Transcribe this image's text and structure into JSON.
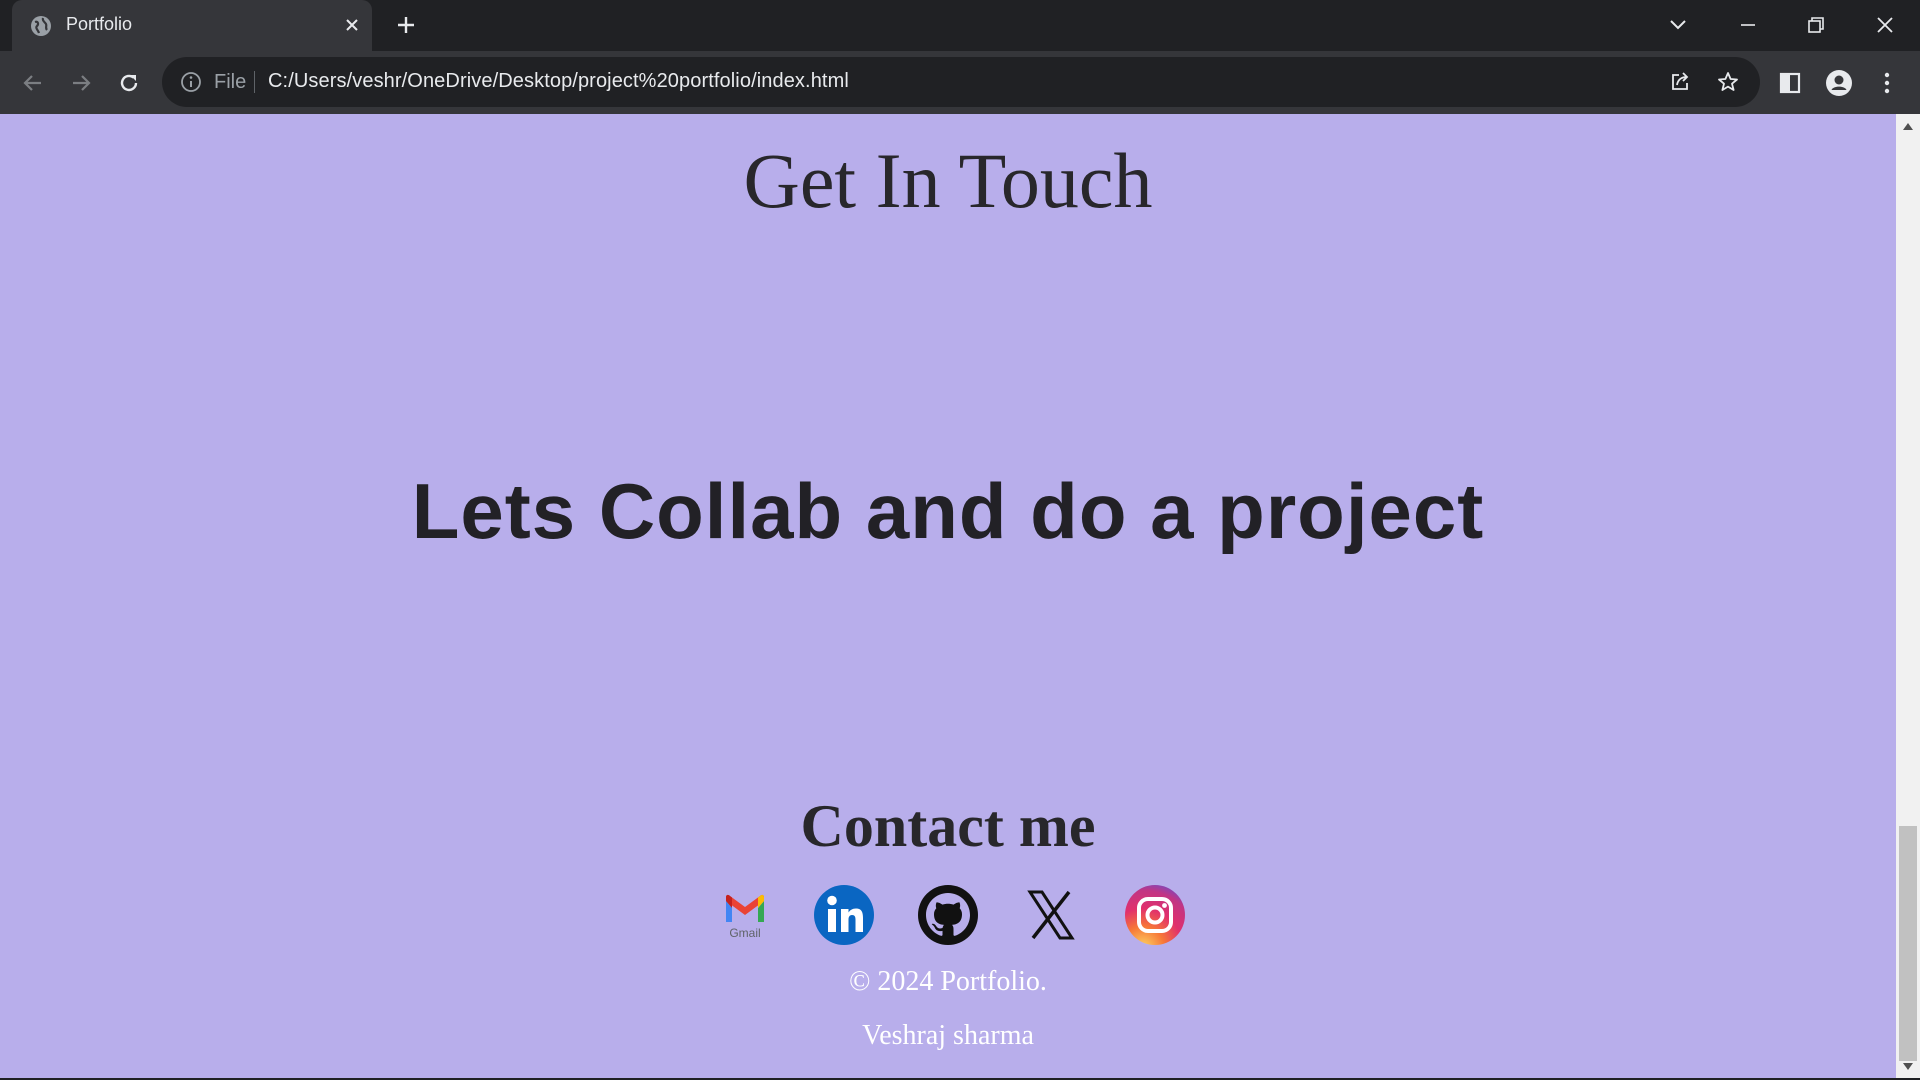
{
  "browser": {
    "tab_title": "Portfolio",
    "scheme_label": "File",
    "url": "C:/Users/veshr/OneDrive/Desktop/project%20portfolio/index.html"
  },
  "page": {
    "background": "#b8aeeb",
    "get_in_touch": "Get In Touch",
    "collab_text": "Lets Collab and do a project",
    "contact_title": "Contact me",
    "social_links": [
      {
        "name": "Gmail",
        "label": "Gmail"
      },
      {
        "name": "LinkedIn",
        "label": "in"
      },
      {
        "name": "GitHub"
      },
      {
        "name": "X"
      },
      {
        "name": "Instagram"
      }
    ],
    "copyright": "© 2024 Portfolio.",
    "author": "Veshraj sharma"
  }
}
